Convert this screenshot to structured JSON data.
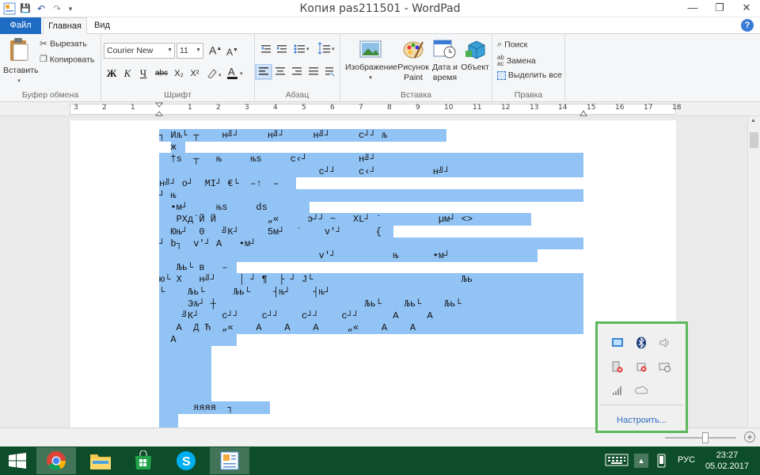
{
  "window": {
    "title": "Копия pas211501 - WordPad",
    "minimize": "—",
    "maximize": "❐",
    "close": "✕"
  },
  "qat": {
    "save": "💾",
    "undo": "↶",
    "redo": "↷",
    "customize": "▾"
  },
  "tabs": {
    "file": "Файл",
    "home": "Главная",
    "view": "Вид",
    "help": "?"
  },
  "ribbon": {
    "clipboard": {
      "label": "Буфер обмена",
      "paste": "Вставить",
      "cut": "Вырезать",
      "copy": "Копировать"
    },
    "font": {
      "label": "Шрифт",
      "family": "Courier New",
      "size": "11",
      "bold": "Ж",
      "italic": "К",
      "underline": "Ч",
      "strike": "abc",
      "sub": "X₂",
      "sup": "X²"
    },
    "paragraph": {
      "label": "Абзац"
    },
    "insert": {
      "label": "Вставка",
      "image": "Изображение",
      "paint": "Рисунок Paint",
      "datetime": "Дата и время",
      "object": "Объект"
    },
    "edit": {
      "label": "Правка",
      "find": "Поиск",
      "replace": "Замена",
      "select_all": "Выделить все"
    }
  },
  "ruler": {
    "marks": [
      "3",
      "2",
      "1",
      "1",
      "2",
      "3",
      "4",
      "5",
      "6",
      "7",
      "8",
      "9",
      "10",
      "11",
      "12",
      "13",
      "14",
      "15",
      "16",
      "17",
      "18"
    ]
  },
  "document": {
    "lines": [
      "┐ Иљ└ ┬    н╝┘     н╝┘     н╝┘     с┘┘ љ",
      "  ж",
      "  †s  ┬   њ     њs     с‹┘         н╝┘",
      "                            с┘┘    с‹┘          н╝┘",
      "н╝┘ о┘  MI┘ €└  –↑  –",
      "┘ њ",
      "  •м┘     њs     ds",
      "   РХд`Й Й         „«     э┘┘ ~   XL┘ `          µм┘ <>",
      "  Юњ┘  0   ╝К┘     5м┘  `    v'┘      {",
      "┘ b┐  v'┘ А   •м┘",
      "                            v'┘          њ      •м┘",
      "   Љь└ в   –",
      "ю└ Х   н╝┘    │ ┘ ¶  ├ ┘ J└                          Љь",
      "└    Љь└     Љь└    ┤њ┘    ┤њ┘",
      "     Эљ┘ ┼                          Љь└    Љь└    Љь└",
      "    ╝К┘    с┘┘    с┘┘    с┘┘    с┘┘      А     А",
      "   А  Д Ћ  „«    А    А    А     „«    А    А",
      "  А"
    ],
    "tail": "      яяяя  ┐"
  },
  "tray_popup": {
    "customize": "Настроить..."
  },
  "taskbar": {
    "language": "РУС",
    "time": "23:27",
    "date": "05.02.2017"
  },
  "colors": {
    "accent": "#1e6bc4",
    "selection": "#92c3f5",
    "taskbar": "#0e4d2a",
    "popup_border": "#5cb85c"
  }
}
